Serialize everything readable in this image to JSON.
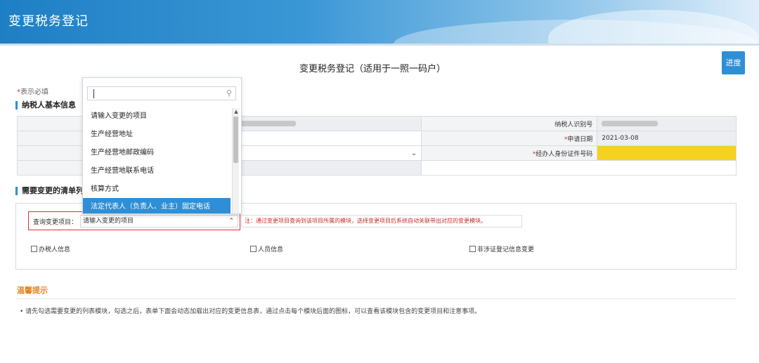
{
  "app": {
    "banner_title": "变更税务登记",
    "page_title": "变更税务登记（适用于一照一码户）",
    "progress_button": "进度"
  },
  "required_note": {
    "star": "*",
    "text": "表示必填"
  },
  "taxpayer_section": {
    "heading": "纳税人基本信息",
    "rows": [
      {
        "right_label": "纳税人识别号"
      },
      {
        "right_label_star": "*",
        "right_label": "申请日期",
        "right_value": "2021-03-08"
      },
      {
        "right_label_star": "*",
        "right_label": "经办人身份证件号码"
      },
      {}
    ]
  },
  "change_section": {
    "heading": "需要变更的清单列",
    "query_label": "查询变更项目：",
    "query_value": "请输入变更的项目",
    "note": "注：通过变更项目查询到该项目所属的模块，选择变更项目后系统自动关联带出对应的变更模块。",
    "checkboxes": [
      "办税人信息",
      "人员信息",
      "非涉证登记信息变更"
    ]
  },
  "dropdown": {
    "search_value": "",
    "items": [
      "请输入变更的项目",
      "生产经营地址",
      "生产经营地邮政编码",
      "生产经营地联系电话",
      "核算方式",
      "法定代表人（负责人、业主）固定电话"
    ],
    "selected_index": 5
  },
  "tips": {
    "title": "温馨提示",
    "text": "• 请先勾选需要变更的列表模块，勾选之后，表单下面会动态加载出对应的变更信息表，通过点击每个模块后面的图标，可以查看该模块包含的变更项目和注意事项。"
  },
  "colors": {
    "accent": "#2e8fd6",
    "required": "#e03030",
    "highlight": "#f5d121",
    "tips": "#e5821f"
  }
}
